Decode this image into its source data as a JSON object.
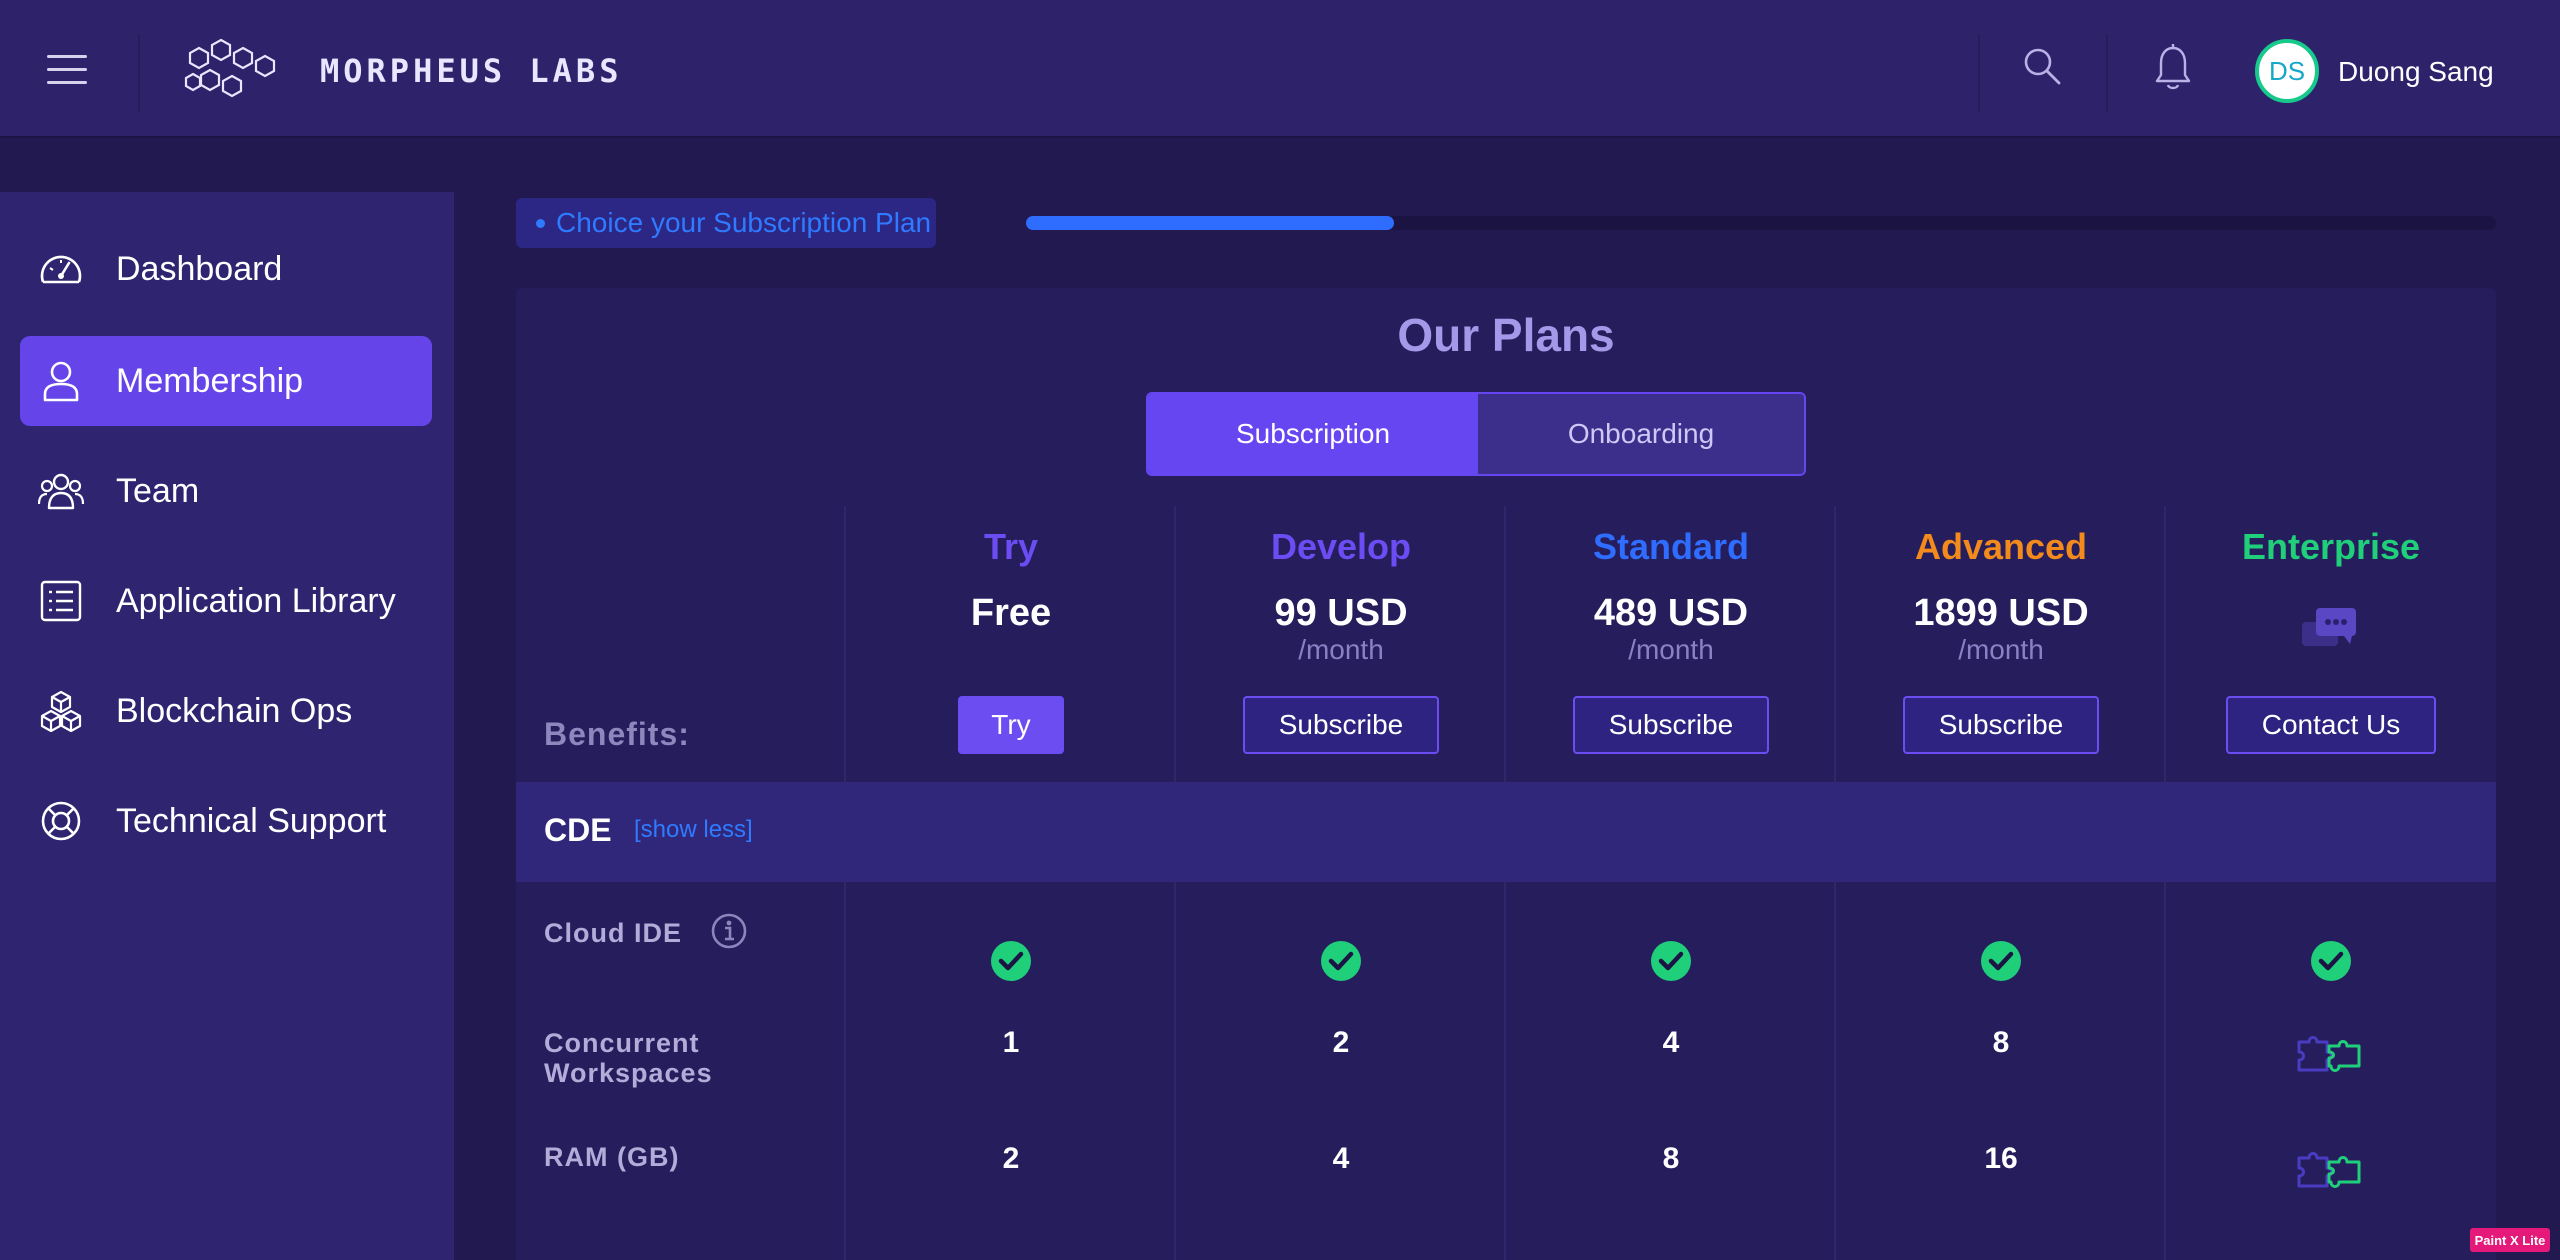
{
  "header": {
    "menu_icon": "hamburger-menu-icon",
    "logo_text": "MORPHEUS LABS",
    "search_icon": "search-icon",
    "bell_icon": "bell-icon",
    "avatar_initials": "DS",
    "user_name": "Duong Sang"
  },
  "sidebar": {
    "items": [
      {
        "label": "Dashboard",
        "icon": "speedometer-icon",
        "active": false
      },
      {
        "label": "Membership",
        "icon": "user-icon",
        "active": true
      },
      {
        "label": "Team",
        "icon": "team-icon",
        "active": false
      },
      {
        "label": "Application Library",
        "icon": "list-icon",
        "active": false
      },
      {
        "label": "Blockchain Ops",
        "icon": "cubes-icon",
        "active": false
      },
      {
        "label": "Technical Support",
        "icon": "lifebuoy-icon",
        "active": false
      }
    ]
  },
  "progress": {
    "step_label": "Choice your Subscription Plan",
    "value_fraction": 0.25
  },
  "plans_page": {
    "title": "Our Plans",
    "tabs": [
      {
        "label": "Subscription",
        "active": true
      },
      {
        "label": "Onboarding",
        "active": false
      }
    ],
    "benefits_label": "Benefits:",
    "plans": [
      {
        "name": "Try",
        "price": "Free",
        "period": "",
        "button": "Try",
        "color": "#6c4df3"
      },
      {
        "name": "Develop",
        "price": "99 USD",
        "period": "/month",
        "button": "Subscribe",
        "color": "#6c4df3"
      },
      {
        "name": "Standard",
        "price": "489 USD",
        "period": "/month",
        "button": "Subscribe",
        "color": "#2e6dff"
      },
      {
        "name": "Advanced",
        "price": "1899 USD",
        "period": "/month",
        "button": "Subscribe",
        "color": "#f28a1c"
      },
      {
        "name": "Enterprise",
        "price": "",
        "period": "",
        "button": "Contact Us",
        "color": "#1fcf7a",
        "icon": "chat-bubbles-icon"
      }
    ],
    "section": {
      "title": "CDE",
      "toggle_link": "[show less]"
    },
    "rows": [
      {
        "label": "Cloud IDE",
        "has_info": true,
        "values": [
          "check",
          "check",
          "check",
          "check",
          "check"
        ]
      },
      {
        "label": "Concurrent Workspaces",
        "values": [
          "1",
          "2",
          "4",
          "8",
          "custom"
        ]
      },
      {
        "label": "RAM (GB)",
        "values": [
          "2",
          "4",
          "8",
          "16",
          "custom"
        ]
      }
    ],
    "icons": {
      "check": "check-circle-icon",
      "custom": "puzzle-pieces-icon",
      "info": "info-icon"
    }
  },
  "colors": {
    "background": "#21194f",
    "header": "#2e236b",
    "sidebar": "#2f2470",
    "accent": "#6545ea",
    "link": "#2f7bff",
    "success": "#1fcf7a"
  },
  "watermark": "Paint X Lite"
}
